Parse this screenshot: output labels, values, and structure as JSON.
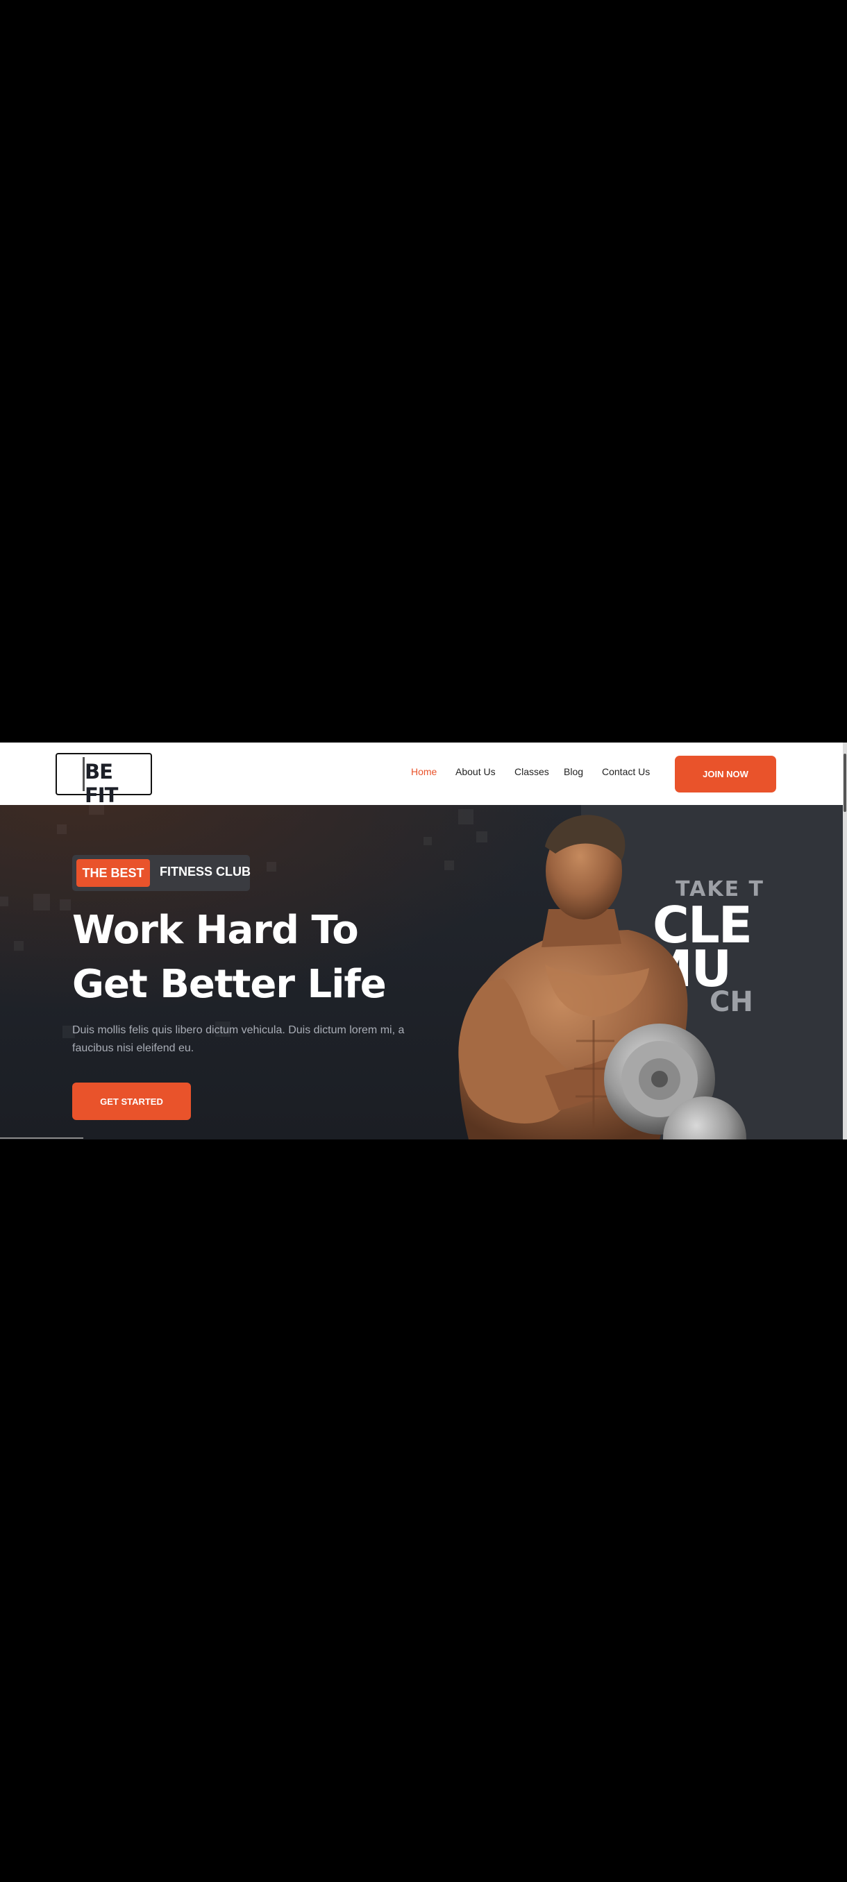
{
  "header": {
    "logo_text": "BE FIT",
    "nav": [
      {
        "label": "Home",
        "active": true
      },
      {
        "label": "About Us",
        "active": false
      },
      {
        "label": "Classes",
        "active": false
      },
      {
        "label": "Blog",
        "active": false
      },
      {
        "label": "Contact Us",
        "active": false
      }
    ],
    "join_label": "JOIN NOW"
  },
  "hero": {
    "badge_left": "THE BEST",
    "badge_right": "FITNESS CLUB",
    "headline_line1": "Work Hard To",
    "headline_line2": "Get Better Life",
    "description": "Duis mollis felis quis libero dictum vehicula. Duis dictum lorem mi, a faucibus nisi eleifend eu.",
    "cta_label": "GET STARTED",
    "promo": {
      "line1": "TAKE T",
      "line2": "CLE",
      "line3": "MU",
      "line4": "CH"
    }
  },
  "colors": {
    "accent": "#e9532b",
    "hero_bg": "#1f2329",
    "header_bg": "#ffffff",
    "text_light": "#ffffff",
    "text_muted": "#a9adb6"
  },
  "icons": {
    "scroll_top": "arrow-up-icon"
  }
}
